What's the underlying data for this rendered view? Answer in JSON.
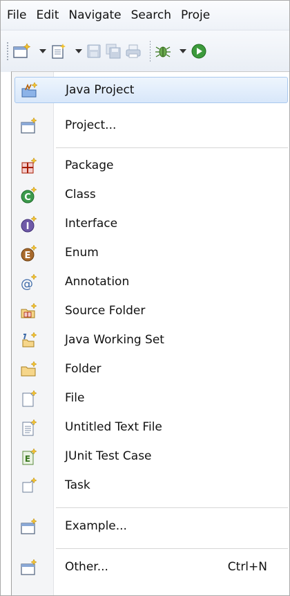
{
  "menubar": {
    "items": [
      "File",
      "Edit",
      "Navigate",
      "Search",
      "Proje"
    ]
  },
  "toolbar": {
    "buttons": [
      "new-wizard-icon",
      "new-file-icon",
      "save-icon",
      "save-all-icon",
      "print-icon",
      "debug-icon",
      "run-icon"
    ]
  },
  "menu": {
    "items": [
      {
        "label": "Java Project",
        "icon": "java-project-icon"
      },
      {
        "label": "Project...",
        "icon": "project-icon"
      },
      {
        "label": "Package",
        "icon": "package-icon"
      },
      {
        "label": "Class",
        "icon": "class-icon"
      },
      {
        "label": "Interface",
        "icon": "interface-icon"
      },
      {
        "label": "Enum",
        "icon": "enum-icon"
      },
      {
        "label": "Annotation",
        "icon": "annotation-icon"
      },
      {
        "label": "Source Folder",
        "icon": "source-folder-icon"
      },
      {
        "label": "Java Working Set",
        "icon": "working-set-icon"
      },
      {
        "label": "Folder",
        "icon": "folder-icon"
      },
      {
        "label": "File",
        "icon": "file-icon"
      },
      {
        "label": "Untitled Text File",
        "icon": "text-file-icon"
      },
      {
        "label": "JUnit Test Case",
        "icon": "junit-icon"
      },
      {
        "label": "Task",
        "icon": "task-icon"
      },
      {
        "label": "Example...",
        "icon": "example-icon"
      },
      {
        "label": "Other...",
        "icon": "other-icon",
        "shortcut": "Ctrl+N"
      }
    ]
  },
  "colors": {
    "hover_bg": "#dceafb",
    "hover_border": "#a8c8ee",
    "gutter": "#f4f5f7"
  }
}
